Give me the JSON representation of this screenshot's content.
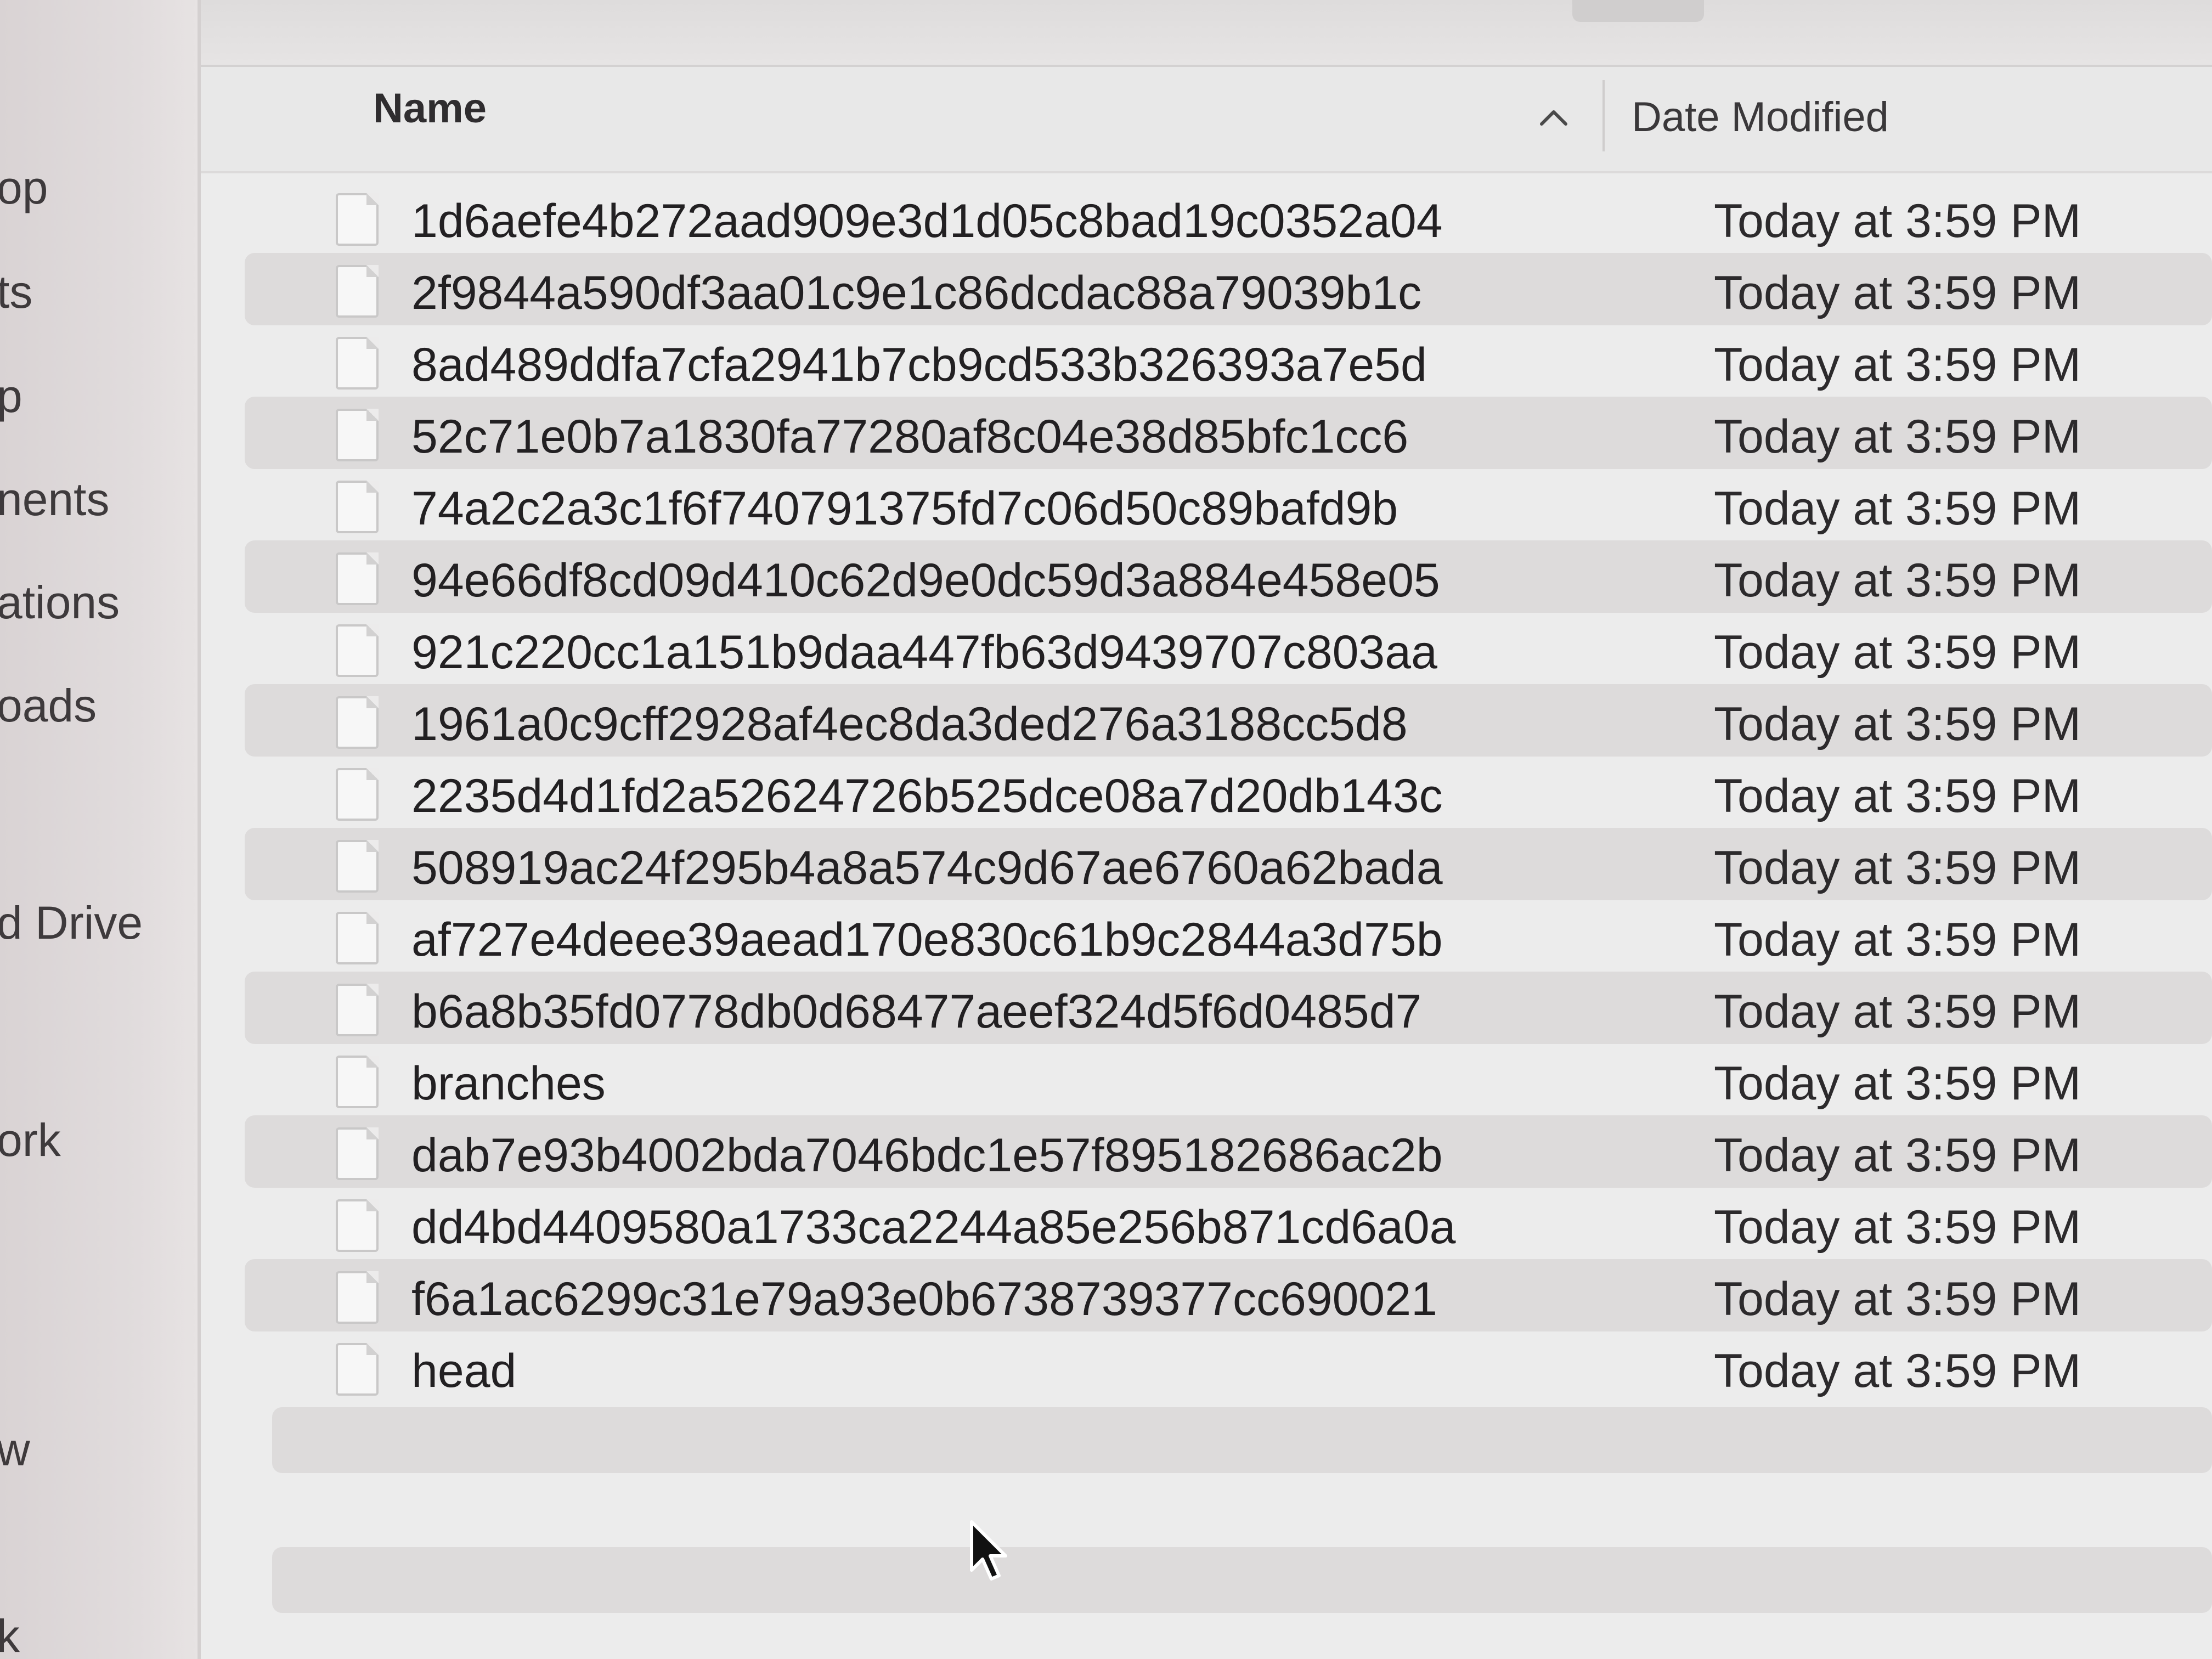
{
  "sidebar": {
    "items": [
      {
        "label": "op"
      },
      {
        "label": "ts"
      },
      {
        "label": "p"
      },
      {
        "label": "nents"
      },
      {
        "label": "ations"
      },
      {
        "label": "oads"
      },
      {
        "label": "d Drive"
      },
      {
        "label": "ork"
      },
      {
        "label": "w"
      },
      {
        "label": "k"
      }
    ]
  },
  "header": {
    "name_label": "Name",
    "sort_indicator": "^",
    "date_label": "Date Modified"
  },
  "files": [
    {
      "name": "1d6aefe4b272aad909e3d1d05c8bad19c0352a04",
      "date": "Today at 3:59 PM"
    },
    {
      "name": "2f9844a590df3aa01c9e1c86dcdac88a79039b1c",
      "date": "Today at 3:59 PM"
    },
    {
      "name": "8ad489ddfa7cfa2941b7cb9cd533b326393a7e5d",
      "date": "Today at 3:59 PM"
    },
    {
      "name": "52c71e0b7a1830fa77280af8c04e38d85bfc1cc6",
      "date": "Today at 3:59 PM"
    },
    {
      "name": "74a2c2a3c1f6f740791375fd7c06d50c89bafd9b",
      "date": "Today at 3:59 PM"
    },
    {
      "name": "94e66df8cd09d410c62d9e0dc59d3a884e458e05",
      "date": "Today at 3:59 PM"
    },
    {
      "name": "921c220cc1a151b9daa447fb63d9439707c803aa",
      "date": "Today at 3:59 PM"
    },
    {
      "name": "1961a0c9cff2928af4ec8da3ded276a3188cc5d8",
      "date": "Today at 3:59 PM"
    },
    {
      "name": "2235d4d1fd2a52624726b525dce08a7d20db143c",
      "date": "Today at 3:59 PM"
    },
    {
      "name": "508919ac24f295b4a8a574c9d67ae6760a62bada",
      "date": "Today at 3:59 PM"
    },
    {
      "name": "af727e4deee39aead170e830c61b9c2844a3d75b",
      "date": "Today at 3:59 PM"
    },
    {
      "name": "b6a8b35fd0778db0d68477aeef324d5f6d0485d7",
      "date": "Today at 3:59 PM"
    },
    {
      "name": "branches",
      "date": "Today at 3:59 PM"
    },
    {
      "name": "dab7e93b4002bda7046bdc1e57f895182686ac2b",
      "date": "Today at 3:59 PM"
    },
    {
      "name": "dd4bd4409580a1733ca2244a85e256b871cd6a0a",
      "date": "Today at 3:59 PM"
    },
    {
      "name": "f6a1ac6299c31e79a93e0b6738739377cc690021",
      "date": "Today at 3:59 PM"
    },
    {
      "name": "head",
      "date": "Today at 3:59 PM"
    }
  ],
  "icons": {
    "file": "document-icon",
    "sort": "chevron-up-icon",
    "cursor": "mouse-pointer-icon"
  }
}
